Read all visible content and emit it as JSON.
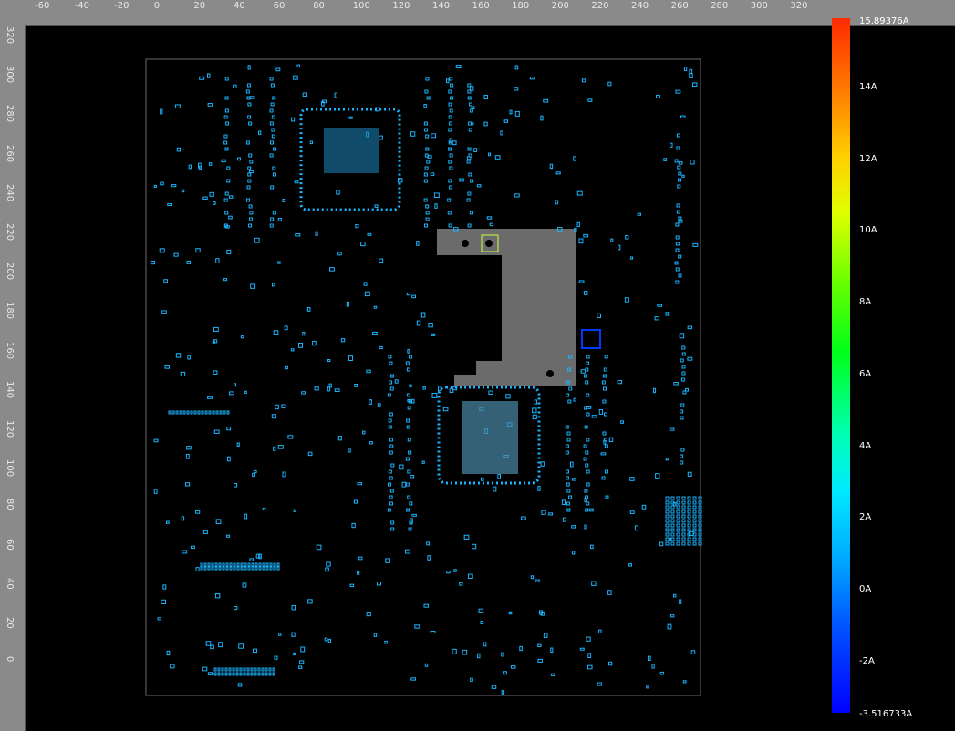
{
  "ruler": {
    "top_labels": [
      "-60",
      "-40",
      "-20",
      "0",
      "20",
      "40",
      "60",
      "80",
      "100",
      "120",
      "140",
      "160",
      "180",
      "200",
      "220",
      "240",
      "260",
      "280",
      "300",
      "320"
    ],
    "left_labels": [
      "320",
      "300",
      "280",
      "260",
      "240",
      "220",
      "200",
      "180",
      "160",
      "140",
      "120",
      "100",
      "80",
      "60",
      "40",
      "20",
      "0"
    ]
  },
  "colorbar": {
    "max_label": "15.89376A",
    "min_label": "-3.516733A",
    "ticks": [
      "14A",
      "12A",
      "10A",
      "8A",
      "6A",
      "4A",
      "2A",
      "0A",
      "-2A"
    ],
    "top_color": "#ff2a00",
    "bottom_color": "#0000ff",
    "pad_color": "#1ab4ff",
    "shape_color": "#6b6b6b"
  }
}
